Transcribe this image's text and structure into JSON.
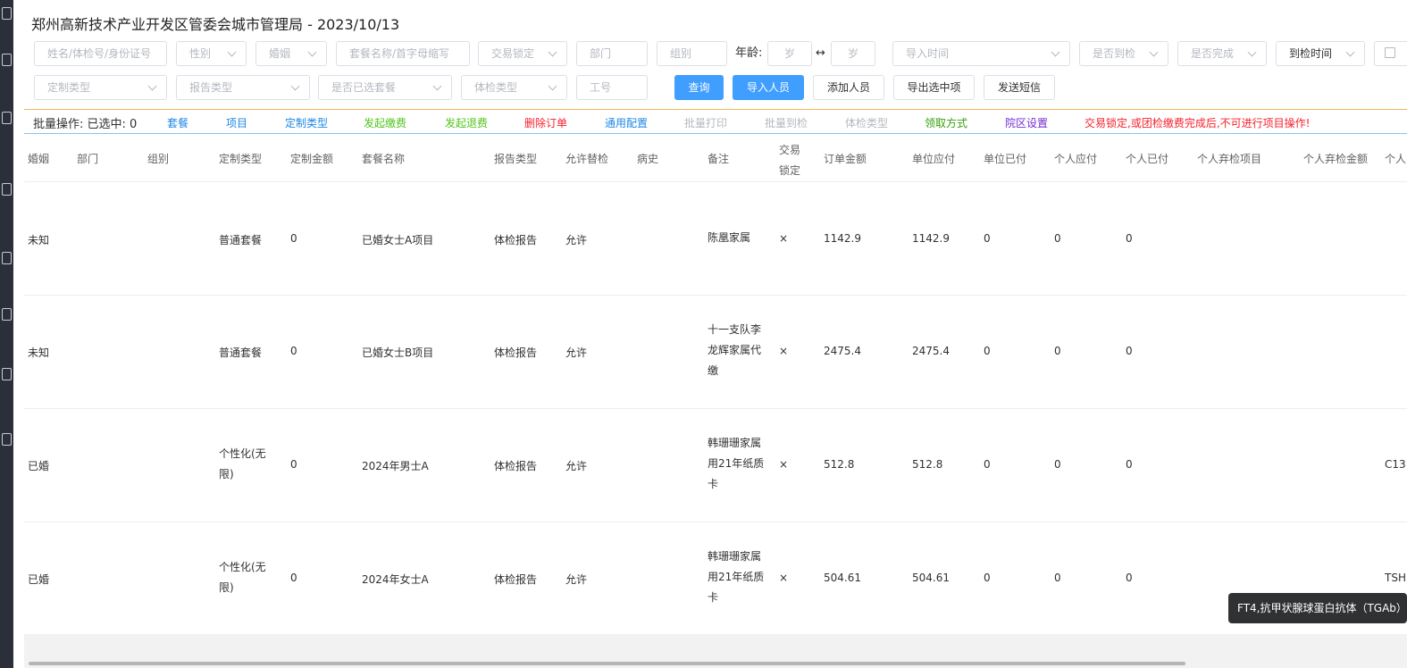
{
  "page": {
    "title": "郑州高新技术产业开发区管委会城市管理局 - 2023/10/13"
  },
  "filters_row1": {
    "name_input": "姓名/体检号/身份证号",
    "gender_select": "性别",
    "marriage_select": "婚姻",
    "package_input": "套餐名称/首字母缩写",
    "trade_lock_select": "交易锁定",
    "department_input": "部门",
    "group_input": "组别",
    "age_label": "年龄:",
    "age_from": "岁",
    "age_sep": "↔",
    "age_to": "岁",
    "import_time_select": "导入时间",
    "arrived_select": "是否到检",
    "finished_select": "是否完成",
    "checkin_time_select": "到检时间"
  },
  "filters_row2": {
    "custom_type_select": "定制类型",
    "report_type_select": "报告类型",
    "package_selected_select": "是否已选套餐",
    "exam_type_select": "体检类型",
    "job_no_input": "工号",
    "query_button": "查询",
    "import_button": "导入人员",
    "add_button": "添加人员",
    "export_button": "导出选中项",
    "sms_button": "发送短信"
  },
  "batch": {
    "lead": "批量操作: 已选中: 0",
    "items": [
      {
        "label": "套餐",
        "color": "#1e88e5"
      },
      {
        "label": "项目",
        "color": "#1e88e5"
      },
      {
        "label": "定制类型",
        "color": "#1e88e5"
      },
      {
        "label": "发起缴费",
        "color": "#52c41a"
      },
      {
        "label": "发起退费",
        "color": "#52c41a"
      },
      {
        "label": "删除订单",
        "color": "#f5222d"
      },
      {
        "label": "通用配置",
        "color": "#1e88e5"
      },
      {
        "label": "批量打印",
        "color": "#b4b8bf"
      },
      {
        "label": "批量到检",
        "color": "#b4b8bf"
      },
      {
        "label": "体检类型",
        "color": "#b4b8bf"
      },
      {
        "label": "领取方式",
        "color": "#389e0d"
      },
      {
        "label": "院区设置",
        "color": "#722ed1"
      }
    ],
    "warning": "交易锁定,或团检缴费完成后,不可进行项目操作!",
    "warning_color": "#f5222d"
  },
  "table": {
    "headers": {
      "marriage": "婚姻",
      "department": "部门",
      "group": "组别",
      "custom_type": "定制类型",
      "custom_amount": "定制金额",
      "package": "套餐名称",
      "report_type": "报告类型",
      "allow_sub": "允许替检",
      "history": "病史",
      "remark": "备注",
      "trade_lock": "交易\n锁定",
      "order_amount": "订单金额",
      "unit_due": "单位应付",
      "unit_paid": "单位已付",
      "personal_due": "个人应付",
      "personal_paid": "个人已付",
      "personal_abandon_items": "个人弃检项目",
      "personal_abandon_amount": "个人弃检金额",
      "cut": "个人"
    },
    "rows": [
      {
        "marriage": "未知",
        "custom_type": "普通套餐",
        "custom_amount": "0",
        "package": "已婚女士A项目",
        "report_type": "体检报告",
        "allow_sub": "允许",
        "remark": "陈凰家属",
        "trade_lock": "×",
        "order_amount": "1142.9",
        "unit_due": "1142.9",
        "unit_paid": "0",
        "personal_due": "0",
        "personal_paid": "0",
        "cut": ""
      },
      {
        "marriage": "未知",
        "custom_type": "普通套餐",
        "custom_amount": "0",
        "package": "已婚女士B项目",
        "report_type": "体检报告",
        "allow_sub": "允许",
        "remark": "十一支队李龙辉家属代缴",
        "trade_lock": "×",
        "order_amount": "2475.4",
        "unit_due": "2475.4",
        "unit_paid": "0",
        "personal_due": "0",
        "personal_paid": "0",
        "cut": ""
      },
      {
        "marriage": "已婚",
        "custom_type": "个性化(无限)",
        "custom_amount": "0",
        "package": "2024年男士A",
        "report_type": "体检报告",
        "allow_sub": "允许",
        "remark": "韩珊珊家属用21年纸质卡",
        "trade_lock": "×",
        "order_amount": "512.8",
        "unit_due": "512.8",
        "unit_paid": "0",
        "personal_due": "0",
        "personal_paid": "0",
        "cut": "C13"
      },
      {
        "marriage": "已婚",
        "custom_type": "个性化(无限)",
        "custom_amount": "0",
        "package": "2024年女士A",
        "report_type": "体检报告",
        "allow_sub": "允许",
        "remark": "韩珊珊家属用21年纸质卡",
        "trade_lock": "×",
        "order_amount": "504.61",
        "unit_due": "504.61",
        "unit_paid": "0",
        "personal_due": "0",
        "personal_paid": "0",
        "cut": "TSH"
      }
    ]
  },
  "tooltip": {
    "text": "FT4,抗甲状腺球蛋白抗体（TGAb）"
  }
}
